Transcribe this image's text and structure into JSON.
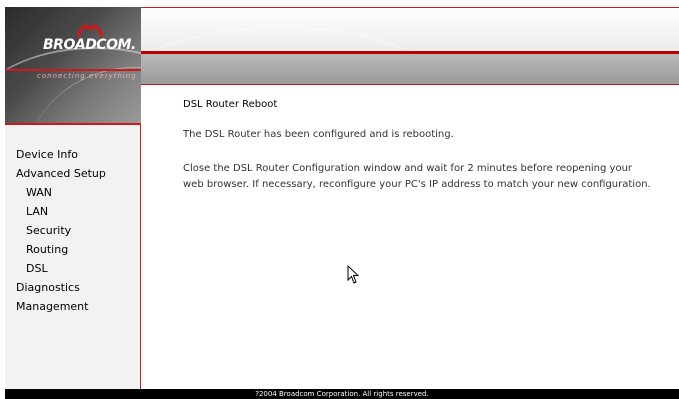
{
  "brand": {
    "name": "BROADCOM.",
    "tagline": "connecting everything"
  },
  "sidebar": {
    "items": [
      {
        "label": "Device Info",
        "level": "top"
      },
      {
        "label": "Advanced Setup",
        "level": "top"
      },
      {
        "label": "WAN",
        "level": "sub"
      },
      {
        "label": "LAN",
        "level": "sub"
      },
      {
        "label": "Security",
        "level": "sub"
      },
      {
        "label": "Routing",
        "level": "sub"
      },
      {
        "label": "DSL",
        "level": "sub"
      },
      {
        "label": "Diagnostics",
        "level": "top"
      },
      {
        "label": "Management",
        "level": "top"
      }
    ]
  },
  "main": {
    "title": "DSL Router Reboot",
    "message1": "The DSL Router has been configured and is rebooting.",
    "message2": "Close the DSL Router Configuration window and wait for 2 minutes before reopening your web browser. If necessary, reconfigure your PC's IP address to match your new configuration."
  },
  "footer": {
    "text": "?2004 Broadcom Corporation.  All rights reserved."
  },
  "colors": {
    "accent_red": "#cc1a1a",
    "sidebar_bg": "#f2f2f2",
    "footer_bg": "#000000"
  }
}
